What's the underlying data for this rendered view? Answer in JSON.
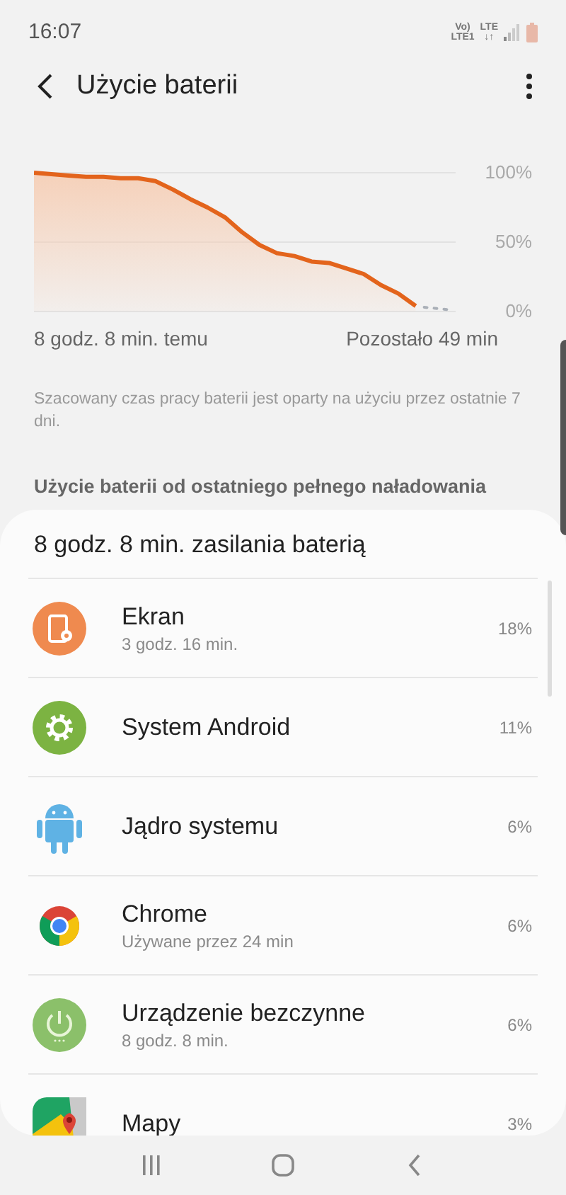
{
  "status_bar": {
    "time": "16:07",
    "indicators": [
      {
        "top": "Vo)",
        "bottom": "LTE1"
      },
      {
        "top": "LTE",
        "bottom": "↓↑"
      }
    ]
  },
  "header": {
    "title": "Użycie baterii"
  },
  "chart": {
    "chart_data": {
      "type": "area",
      "categories": [
        null,
        null,
        null,
        null,
        null,
        null,
        null,
        null,
        null,
        null,
        null,
        null,
        null,
        null,
        null,
        null,
        null,
        null,
        null,
        null,
        null,
        null,
        null
      ],
      "ylim": [
        0,
        100
      ],
      "yticks": [
        {
          "value": 100,
          "label": "100%"
        },
        {
          "value": 50,
          "label": "50%"
        },
        {
          "value": 0,
          "label": "0%"
        }
      ],
      "series": [
        {
          "color": "#e3641c",
          "values": [
            100,
            99,
            98,
            97,
            97,
            96,
            96,
            94,
            88,
            81,
            75,
            68,
            57,
            48,
            42,
            40,
            36,
            35,
            31,
            27,
            19,
            13,
            4
          ]
        }
      ]
    },
    "start_label": "8 godz. 8 min. temu",
    "end_label": "Pozostało 49 min"
  },
  "note": "Szacowany czas pracy baterii jest oparty na użyciu przez ostatnie 7 dni.",
  "section_title": "Użycie baterii od ostatniego pełnego naładowania",
  "usage": {
    "total": "8 godz. 8 min. zasilania baterią",
    "apps": [
      {
        "kind": "screen",
        "name": "Ekran",
        "detail": "3 godz. 16 min.",
        "percent": "18%"
      },
      {
        "kind": "system",
        "name": "System Android",
        "percent": "11%"
      },
      {
        "kind": "android",
        "name": "Jądro systemu",
        "percent": "6%"
      },
      {
        "kind": "chrome",
        "name": "Chrome",
        "detail": "Używane przez 24 min",
        "percent": "6%"
      },
      {
        "kind": "idle",
        "name": "Urządzenie bezczynne",
        "detail": "8 godz. 8 min.",
        "percent": "6%"
      },
      {
        "kind": "maps",
        "name": "Mapy",
        "percent": "3%"
      }
    ]
  }
}
